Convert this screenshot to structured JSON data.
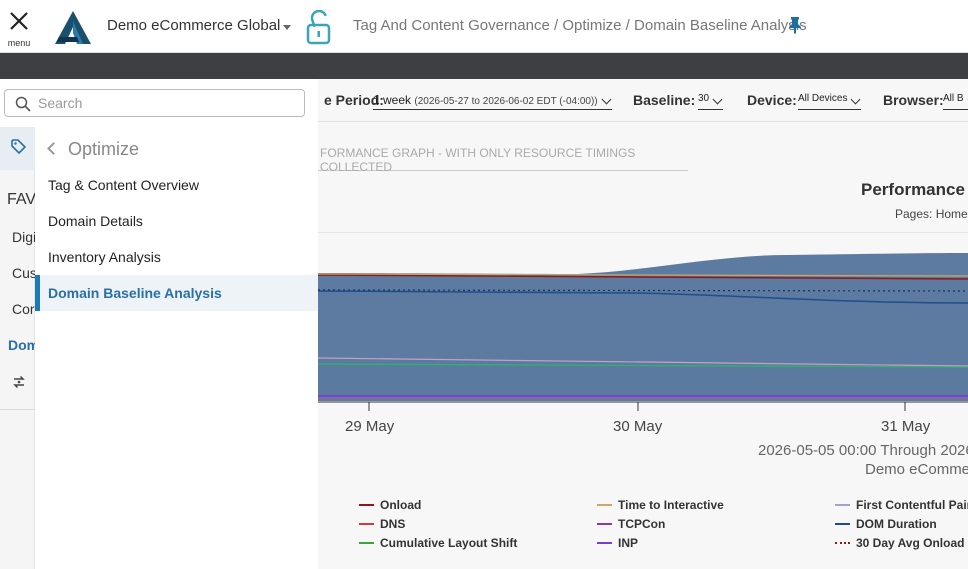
{
  "header": {
    "menu_label": "menu",
    "org_name": "Demo eCommerce Global",
    "breadcrumb": [
      "Tag And Content Governance",
      "Optimize",
      "Domain Baseline Analysis"
    ],
    "breadcrumb_sep": " / "
  },
  "filters": {
    "period_label": "e Period:",
    "period_value": "1 week",
    "period_range": "(2026-05-27 to 2026-06-02 EDT (-04:00))",
    "baseline_label": "Baseline:",
    "baseline_value": "30",
    "device_label": "Device:",
    "device_value": "All Devices",
    "browser_label": "Browser:",
    "browser_value": "All B"
  },
  "chart_tab": "FORMANCE GRAPH - WITH ONLY RESOURCE TIMINGS COLLECTED",
  "chart": {
    "title": "Performance",
    "subtitle": "Pages: Homel",
    "x_ticks": [
      "29 May",
      "30 May",
      "31 May"
    ],
    "range_text": "2026-05-05 00:00 Through 2026",
    "org_text": "Demo eComme"
  },
  "chart_data": {
    "type": "area",
    "title": "Performance",
    "categories": [
      "29 May",
      "30 May",
      "31 May"
    ],
    "series": [
      {
        "name": "Onload",
        "color": "#8b1a1a"
      },
      {
        "name": "DNS",
        "color": "#d33a3a"
      },
      {
        "name": "Cumulative Layout Shift",
        "color": "#3aa63a"
      },
      {
        "name": "Time to Interactive",
        "color": "#c8a96a"
      },
      {
        "name": "TCPCon",
        "color": "#8a3aa6"
      },
      {
        "name": "INP",
        "color": "#7a3ad6"
      },
      {
        "name": "First Contentful Pain",
        "color": "#a8a0c8"
      },
      {
        "name": "DOM Duration",
        "color": "#1f4e8c"
      },
      {
        "name": "30 Day Avg Onload",
        "color": "#8b1a1a"
      }
    ]
  },
  "search": {
    "placeholder": "Search"
  },
  "rail": {
    "fav_label": "FAV",
    "items": [
      "Digi",
      "Cus",
      "Cor",
      "Dom"
    ]
  },
  "drawer": {
    "back_label": "Optimize",
    "items": [
      {
        "label": "Tag & Content Overview",
        "active": false
      },
      {
        "label": "Domain Details",
        "active": false
      },
      {
        "label": "Inventory Analysis",
        "active": false
      },
      {
        "label": "Domain Baseline Analysis",
        "active": true
      }
    ]
  },
  "icons": {
    "close": "close-icon",
    "logo": "brand-logo",
    "lock": "unlock-icon",
    "pin": "pin-icon",
    "search": "search-icon",
    "tag": "tag-icon",
    "refresh": "swap-icon"
  },
  "colors": {
    "accent": "#1c7bb5",
    "active_text": "#2a6fa8",
    "dark_bar": "#3d3f42"
  }
}
